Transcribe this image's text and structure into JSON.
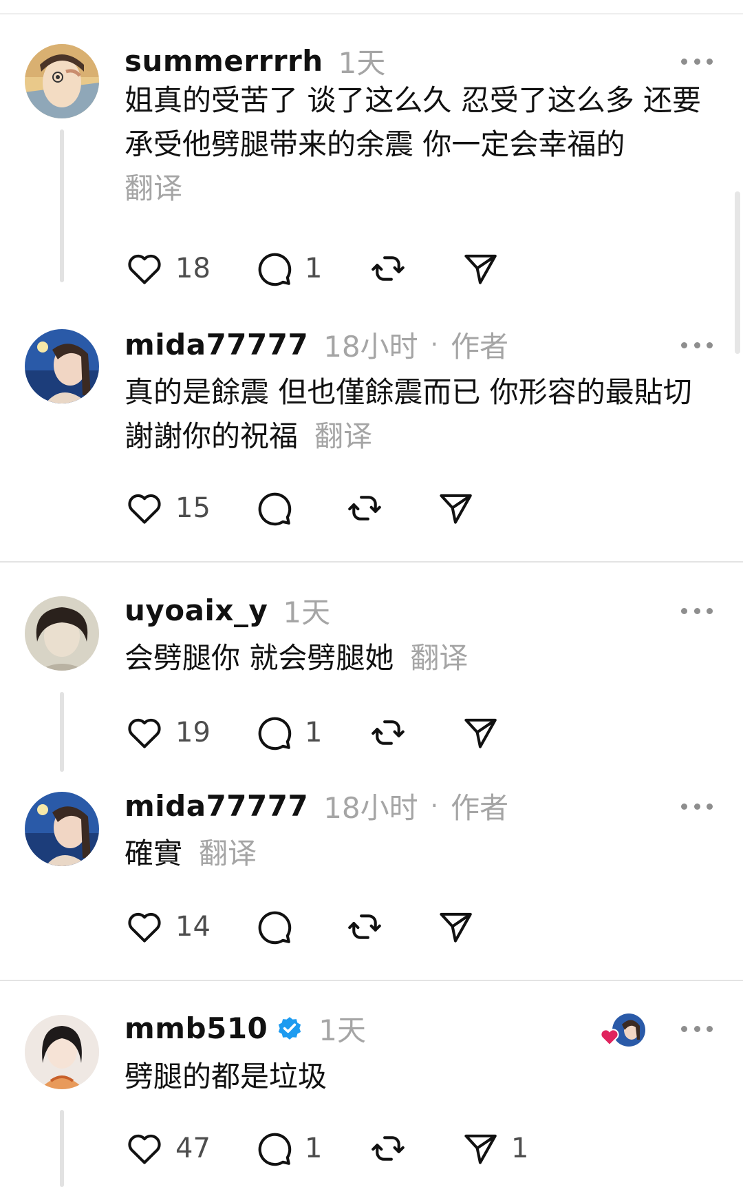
{
  "translate_label": "翻译",
  "threads": [
    {
      "comment": {
        "username": "summerrrrh",
        "time": "1天",
        "text": "姐真的受苦了 谈了这么久 忍受了这么多 还要承受他劈腿带来的余震 你一定会幸福的",
        "likes": "18",
        "replies": "1",
        "reposts": "",
        "shares": ""
      },
      "reply": {
        "username": "mida77777",
        "time": "18小时",
        "author_tag": "作者",
        "text": "真的是餘震 但也僅餘震而已 你形容的最貼切 謝謝你的祝福",
        "likes": "15",
        "replies": "",
        "reposts": "",
        "shares": ""
      }
    },
    {
      "comment": {
        "username": "uyoaix_y",
        "time": "1天",
        "text": "会劈腿你 就会劈腿她",
        "likes": "19",
        "replies": "1",
        "reposts": "",
        "shares": ""
      },
      "reply": {
        "username": "mida77777",
        "time": "18小时",
        "author_tag": "作者",
        "text": "確實",
        "likes": "14",
        "replies": "",
        "reposts": "",
        "shares": ""
      }
    },
    {
      "comment": {
        "username": "mmb510",
        "verified": true,
        "time": "1天",
        "text": "劈腿的都是垃圾",
        "likes": "47",
        "replies": "1",
        "reposts": "",
        "shares": "1"
      }
    }
  ],
  "colors": {
    "text": "#111111",
    "muted": "#a5a5a5",
    "verified_blue": "#1d9bf0",
    "liked_heart": "#e0245e",
    "divider": "#e3e3e3"
  },
  "icons": [
    "heart-icon",
    "comment-icon",
    "repost-icon",
    "share-icon",
    "more-icon",
    "verified-badge-icon"
  ]
}
